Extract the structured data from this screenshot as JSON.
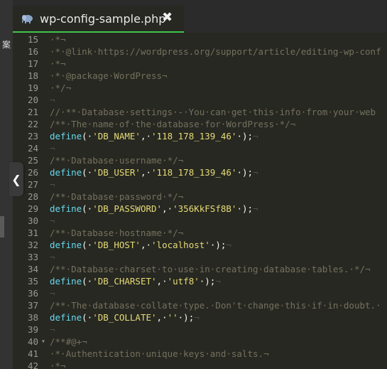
{
  "tab": {
    "title": "wp-config-sample.php",
    "close_glyph": "✖",
    "icon": "php-elephant-icon"
  },
  "leftpanel": {
    "text": "案",
    "collapse_glyph": "❮"
  },
  "colors": {
    "accent_underline": "#3fc64b",
    "keyword": "#66d9ef",
    "string": "#e6db74",
    "comment": "#75715e"
  },
  "lines": [
    {
      "n": "15",
      "fold": "",
      "parts": [
        [
          "c",
          "·*¬"
        ]
      ]
    },
    {
      "n": "16",
      "fold": "",
      "parts": [
        [
          "c",
          "·*·@link·https://wordpress.org/support/article/editing-wp-conf"
        ]
      ]
    },
    {
      "n": "17",
      "fold": "",
      "parts": [
        [
          "c",
          "·*¬"
        ]
      ]
    },
    {
      "n": "18",
      "fold": "",
      "parts": [
        [
          "c",
          "·*·@package·WordPress¬"
        ]
      ]
    },
    {
      "n": "19",
      "fold": "",
      "parts": [
        [
          "c",
          "·*/¬"
        ]
      ]
    },
    {
      "n": "20",
      "fold": "",
      "parts": [
        [
          "ws",
          "¬"
        ]
      ]
    },
    {
      "n": "21",
      "fold": "",
      "parts": [
        [
          "c",
          "//·**·Database·settings·-·You·can·get·this·info·from·your·web"
        ]
      ]
    },
    {
      "n": "22",
      "fold": "",
      "parts": [
        [
          "c",
          "/**·The·name·of·the·database·for·WordPress·*/¬"
        ]
      ]
    },
    {
      "n": "23",
      "fold": "",
      "parts": [
        [
          "k",
          "define"
        ],
        [
          "p",
          "(·"
        ],
        [
          "s",
          "'DB_NAME'"
        ],
        [
          "p",
          ",·"
        ],
        [
          "s",
          "'118_178_139_46'"
        ],
        [
          "p",
          "·);"
        ],
        [
          "ws",
          "¬"
        ]
      ]
    },
    {
      "n": "24",
      "fold": "",
      "parts": [
        [
          "ws",
          "¬"
        ]
      ]
    },
    {
      "n": "25",
      "fold": "",
      "parts": [
        [
          "c",
          "/**·Database·username·*/¬"
        ]
      ]
    },
    {
      "n": "26",
      "fold": "",
      "parts": [
        [
          "k",
          "define"
        ],
        [
          "p",
          "(·"
        ],
        [
          "s",
          "'DB_USER'"
        ],
        [
          "p",
          ",·"
        ],
        [
          "s",
          "'118_178_139_46'"
        ],
        [
          "p",
          "·);"
        ],
        [
          "ws",
          "¬"
        ]
      ]
    },
    {
      "n": "27",
      "fold": "",
      "parts": [
        [
          "ws",
          "¬"
        ]
      ]
    },
    {
      "n": "28",
      "fold": "",
      "parts": [
        [
          "c",
          "/**·Database·password·*/¬"
        ]
      ]
    },
    {
      "n": "29",
      "fold": "",
      "parts": [
        [
          "k",
          "define"
        ],
        [
          "p",
          "(·"
        ],
        [
          "s",
          "'DB_PASSWORD'"
        ],
        [
          "p",
          ",·"
        ],
        [
          "s",
          "'356KkFSf8B'"
        ],
        [
          "p",
          "·);"
        ],
        [
          "ws",
          "¬"
        ]
      ]
    },
    {
      "n": "30",
      "fold": "",
      "parts": [
        [
          "ws",
          "¬"
        ]
      ]
    },
    {
      "n": "31",
      "fold": "",
      "parts": [
        [
          "c",
          "/**·Database·hostname·*/¬"
        ]
      ]
    },
    {
      "n": "32",
      "fold": "",
      "parts": [
        [
          "k",
          "define"
        ],
        [
          "p",
          "(·"
        ],
        [
          "s",
          "'DB_HOST'"
        ],
        [
          "p",
          ",·"
        ],
        [
          "s",
          "'localhost'"
        ],
        [
          "p",
          "·);"
        ],
        [
          "ws",
          "¬"
        ]
      ]
    },
    {
      "n": "33",
      "fold": "",
      "parts": [
        [
          "ws",
          "¬"
        ]
      ]
    },
    {
      "n": "34",
      "fold": "",
      "parts": [
        [
          "c",
          "/**·Database·charset·to·use·in·creating·database·tables.·*/¬"
        ]
      ]
    },
    {
      "n": "35",
      "fold": "",
      "parts": [
        [
          "k",
          "define"
        ],
        [
          "p",
          "(·"
        ],
        [
          "s",
          "'DB_CHARSET'"
        ],
        [
          "p",
          ",·"
        ],
        [
          "s",
          "'utf8'"
        ],
        [
          "p",
          "·);"
        ],
        [
          "ws",
          "¬"
        ]
      ]
    },
    {
      "n": "36",
      "fold": "",
      "parts": [
        [
          "ws",
          "¬"
        ]
      ]
    },
    {
      "n": "37",
      "fold": "",
      "parts": [
        [
          "c",
          "/**·The·database·collate·type.·Don't·change·this·if·in·doubt.·"
        ]
      ]
    },
    {
      "n": "38",
      "fold": "",
      "parts": [
        [
          "k",
          "define"
        ],
        [
          "p",
          "(·"
        ],
        [
          "s",
          "'DB_COLLATE'"
        ],
        [
          "p",
          ",·"
        ],
        [
          "s",
          "''"
        ],
        [
          "p",
          "·);"
        ],
        [
          "ws",
          "¬"
        ]
      ]
    },
    {
      "n": "39",
      "fold": "",
      "parts": [
        [
          "ws",
          "¬"
        ]
      ]
    },
    {
      "n": "40",
      "fold": "▾",
      "parts": [
        [
          "c",
          "/**#@+¬"
        ]
      ]
    },
    {
      "n": "41",
      "fold": "",
      "parts": [
        [
          "c",
          "·*·Authentication·unique·keys·and·salts.¬"
        ]
      ]
    },
    {
      "n": "42",
      "fold": "",
      "parts": [
        [
          "c",
          "·*¬"
        ]
      ]
    }
  ]
}
